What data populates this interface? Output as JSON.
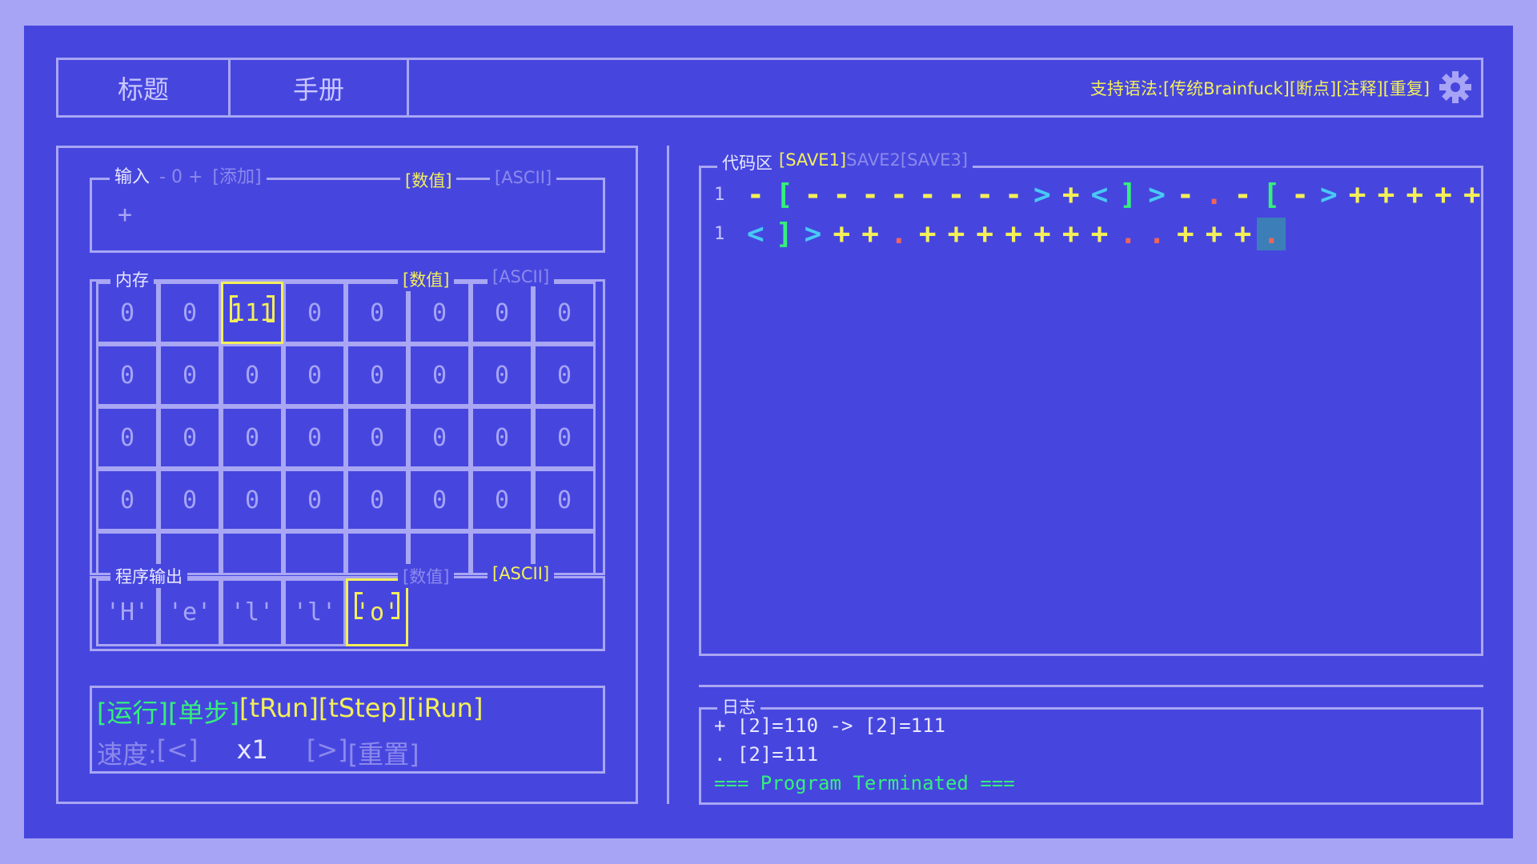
{
  "header": {
    "tabs": [
      "标题",
      "手册"
    ],
    "syntax_prefix": "支持语法:",
    "syntax_items": [
      "[传统Brainfuck]",
      "[断点]",
      "[注释]",
      "[重复]"
    ]
  },
  "input_panel": {
    "title": "输入",
    "stepper": "- 0 +",
    "add": "[添加]",
    "mode_num": "[数值]",
    "mode_ascii": "[ASCII]",
    "value": "+"
  },
  "memory_panel": {
    "title": "内存",
    "mode_num": "[数值]",
    "mode_ascii": "[ASCII]",
    "selected_index": 2,
    "cells": [
      "0",
      "0",
      "111",
      "0",
      "0",
      "0",
      "0",
      "0",
      "0",
      "0",
      "0",
      "0",
      "0",
      "0",
      "0",
      "0",
      "0",
      "0",
      "0",
      "0",
      "0",
      "0",
      "0",
      "0",
      "0",
      "0",
      "0",
      "0",
      "0",
      "0",
      "0",
      "0"
    ]
  },
  "output_panel": {
    "title": "程序输出",
    "mode_num": "[数值]",
    "mode_ascii": "[ASCII]",
    "selected_index": 4,
    "cells": [
      "'H'",
      "'e'",
      "'l'",
      "'l'",
      "'o'"
    ]
  },
  "controls": {
    "run": "[运行]",
    "step": "[单步]",
    "trun": "[tRun]",
    "tstep": "[tStep]",
    "irun": "[iRun]",
    "speed_label": "速度:",
    "slower": "[<]",
    "speed_value": "x1",
    "faster": "[>]",
    "reset": "[重置]"
  },
  "code_area": {
    "title": "代码区",
    "saves": [
      "[SAVE1]",
      "SAVE2",
      "[SAVE3]"
    ],
    "lines": [
      {
        "num": "1",
        "tokens": [
          "-",
          "[",
          "-",
          "-",
          "-",
          "-",
          "-",
          "-",
          "-",
          "-",
          ">",
          "+",
          "<",
          "]",
          ">",
          "-",
          ".",
          "-",
          "[",
          "-",
          ">",
          "+",
          "+",
          "+",
          "+",
          "+"
        ]
      },
      {
        "num": "1",
        "tokens": [
          "<",
          "]",
          ">",
          "+",
          "+",
          ".",
          "+",
          "+",
          "+",
          "+",
          "+",
          "+",
          "+",
          ".",
          ".",
          "+",
          "+",
          "+",
          "."
        ]
      }
    ],
    "token_colors": {
      "-": "#f3ef5a",
      "+": "#f3ef5a",
      "[": "#35f07a",
      "]": "#35f07a",
      "<": "#48c9f4",
      ">": "#48c9f4",
      ".": "#f0645a"
    },
    "cursor": {
      "line": 1,
      "index": 18
    }
  },
  "log": {
    "title": "日志",
    "lines": [
      "+ [2]=110 -> [2]=111",
      ". [2]=111",
      "=== Program Terminated ==="
    ]
  }
}
